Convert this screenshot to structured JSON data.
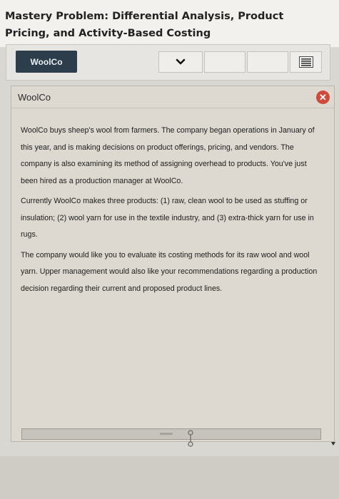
{
  "page": {
    "title": "Mastery Problem: Differential Analysis, Product Pricing, and Activity-Based Costing"
  },
  "toolbar": {
    "tab_label": "WoolCo",
    "nav_icon": "chevron-down-icon",
    "menu_icon": "menu-icon"
  },
  "panel": {
    "title": "WoolCo",
    "close_icon": "close-icon",
    "paragraphs": [
      "WoolCo buys sheep's wool from farmers. The company began operations in January of this year, and is making decisions on product offerings, pricing, and vendors. The company is also examining its method of assigning overhead to products. You've just been hired as a production manager at WoolCo.",
      "Currently WoolCo makes three products: (1) raw, clean wool to be used as stuffing or insulation; (2) wool yarn for use in the textile industry, and (3) extra-thick yarn for use in rugs.",
      "The company would like you to evaluate its costing methods for its raw wool and wool yarn. Upper management would also like your recommendations regarding a production decision regarding their current and proposed product lines."
    ]
  },
  "colors": {
    "tab_background": "#2c3e4c",
    "close_button": "#cf4a3a",
    "panel_background": "#ddd9d0"
  }
}
